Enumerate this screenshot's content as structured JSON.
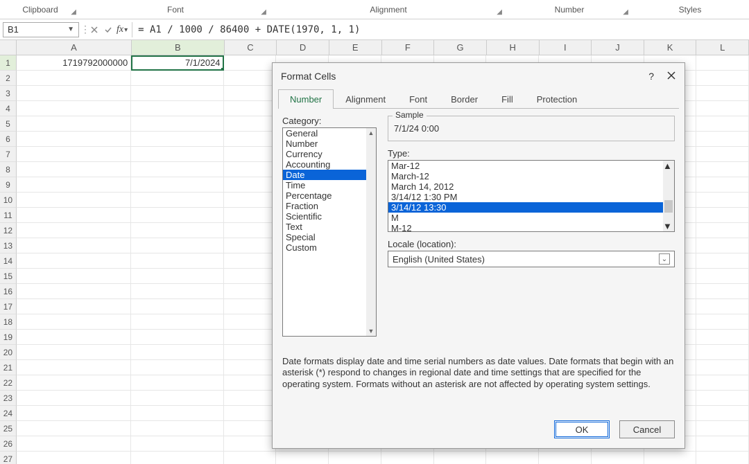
{
  "ribbon": {
    "groups": [
      "Clipboard",
      "Font",
      "Alignment",
      "Number",
      "Styles"
    ]
  },
  "namebox": "B1",
  "formula": "= A1 / 1000 / 86400 + DATE(1970, 1, 1)",
  "columns": [
    "A",
    "B",
    "C",
    "D",
    "E",
    "F",
    "G",
    "H",
    "I",
    "J",
    "K",
    "L"
  ],
  "col_widths": {
    "A": 180,
    "B": 145
  },
  "default_col_width": 82,
  "rows": 27,
  "cells": {
    "A1": "1719792000000",
    "B1": "7/1/2024"
  },
  "active_cell": "B1",
  "dialog": {
    "title": "Format Cells",
    "tabs": [
      "Number",
      "Alignment",
      "Font",
      "Border",
      "Fill",
      "Protection"
    ],
    "active_tab": 0,
    "category_label": "Category:",
    "categories": [
      "General",
      "Number",
      "Currency",
      "Accounting",
      "Date",
      "Time",
      "Percentage",
      "Fraction",
      "Scientific",
      "Text",
      "Special",
      "Custom"
    ],
    "selected_category": 4,
    "sample_label": "Sample",
    "sample_value": "7/1/24 0:00",
    "type_label": "Type:",
    "types": [
      "Mar-12",
      "March-12",
      "March 14, 2012",
      "3/14/12 1:30 PM",
      "3/14/12 13:30",
      "M",
      "M-12"
    ],
    "selected_type": 4,
    "locale_label": "Locale (location):",
    "locale_value": "English (United States)",
    "description": "Date formats display date and time serial numbers as date values.  Date formats that begin with an asterisk (*) respond to changes in regional date and time settings that are specified for the operating system. Formats without an asterisk are not affected by operating system settings.",
    "ok": "OK",
    "cancel": "Cancel",
    "help": "?"
  }
}
